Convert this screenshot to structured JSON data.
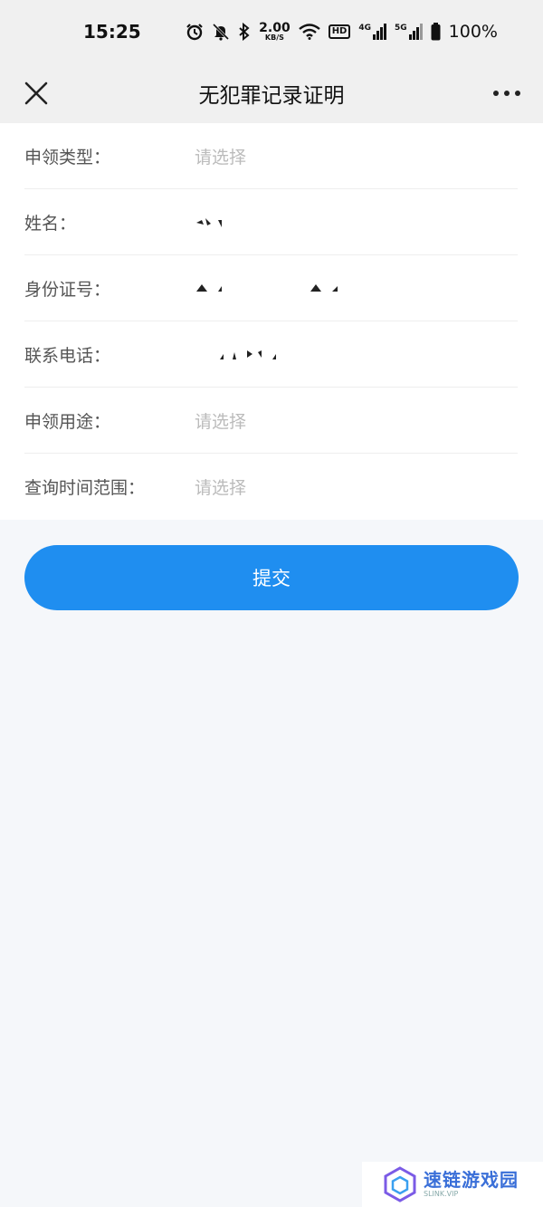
{
  "status_bar": {
    "time": "15:25",
    "net_speed_value": "2.00",
    "net_speed_unit": "KB/S",
    "hd_label": "HD",
    "signal_4g": "4G",
    "signal_5g": "5G",
    "battery": "100%",
    "icons": [
      "alarm-icon",
      "mute-icon",
      "bluetooth-icon",
      "wifi-icon",
      "battery-icon"
    ]
  },
  "nav": {
    "title": "无犯罪记录证明",
    "close_icon": "close-icon",
    "more_icon": "more-icon"
  },
  "form": {
    "fields": [
      {
        "label": "申领类型：",
        "value": "",
        "placeholder": "请选择"
      },
      {
        "label": "姓名：",
        "value": "",
        "placeholder": ""
      },
      {
        "label": "身份证号：",
        "value": "",
        "placeholder": ""
      },
      {
        "label": "联系电话：",
        "value": "",
        "placeholder": ""
      },
      {
        "label": "申领用途：",
        "value": "",
        "placeholder": "请选择"
      },
      {
        "label": "查询时间范围：",
        "value": "",
        "placeholder": "请选择"
      }
    ]
  },
  "submit": {
    "label": "提交"
  },
  "watermark": {
    "main": "速链游戏园",
    "sub": "SLINK.VIP"
  },
  "colors": {
    "accent": "#1f8ef0",
    "background": "#f5f7fa",
    "header": "#f0f0f0"
  }
}
